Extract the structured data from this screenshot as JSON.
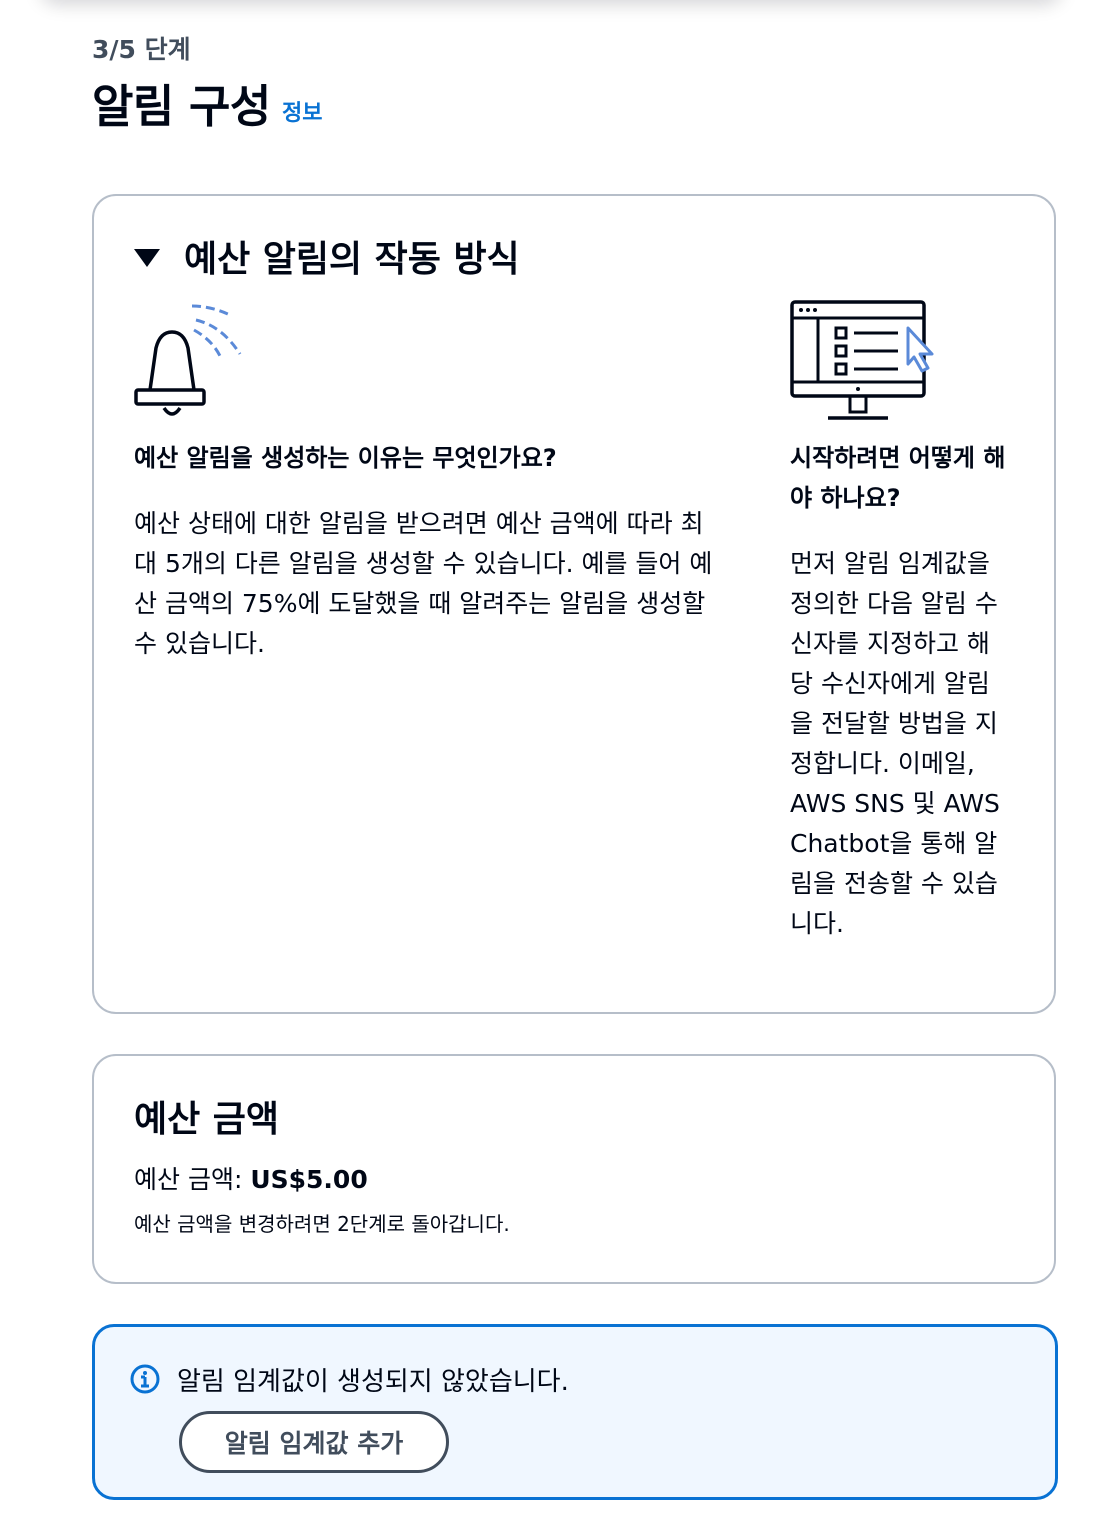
{
  "header": {
    "step": "3/5 단계",
    "title": "알림 구성",
    "info_link": "정보"
  },
  "how_it_works": {
    "title": "예산 알림의 작동 방식",
    "why_heading": "예산 알림을 생성하는 이유는 무엇인가요?",
    "why_body": "예산 상태에 대한 알림을 받으려면 예산 금액에 따라 최대 5개의 다른 알림을 생성할 수 있습니다. 예를 들어 예산 금액의 75%에 도달했을 때 알려주는 알림을 생성할 수 있습니다.",
    "start_heading": "시작하려면 어떻게 해야 하나요?",
    "start_body": "먼저 알림 임계값을 정의한 다음 알림 수신자를 지정하고 해당 수신자에게 알림을 전달할 방법을 지정합니다. 이메일, AWS SNS 및 AWS Chatbot을 통해 알림을 전송할 수 있습니다."
  },
  "budget_amount": {
    "title": "예산 금액",
    "label": "예산 금액: ",
    "value": "US$5.00",
    "hint": "예산 금액을 변경하려면 2단계로 돌아갑니다."
  },
  "alert": {
    "message": "알림 임계값이 생성되지 않았습니다.",
    "button_label": "알림 임계값 추가"
  },
  "colors": {
    "accent": "#0972d3",
    "text": "#000716",
    "muted": "#414d5c",
    "border": "#b6bec9",
    "alert_bg": "#f0f7ff",
    "icon_accent": "#5b8ad8"
  }
}
